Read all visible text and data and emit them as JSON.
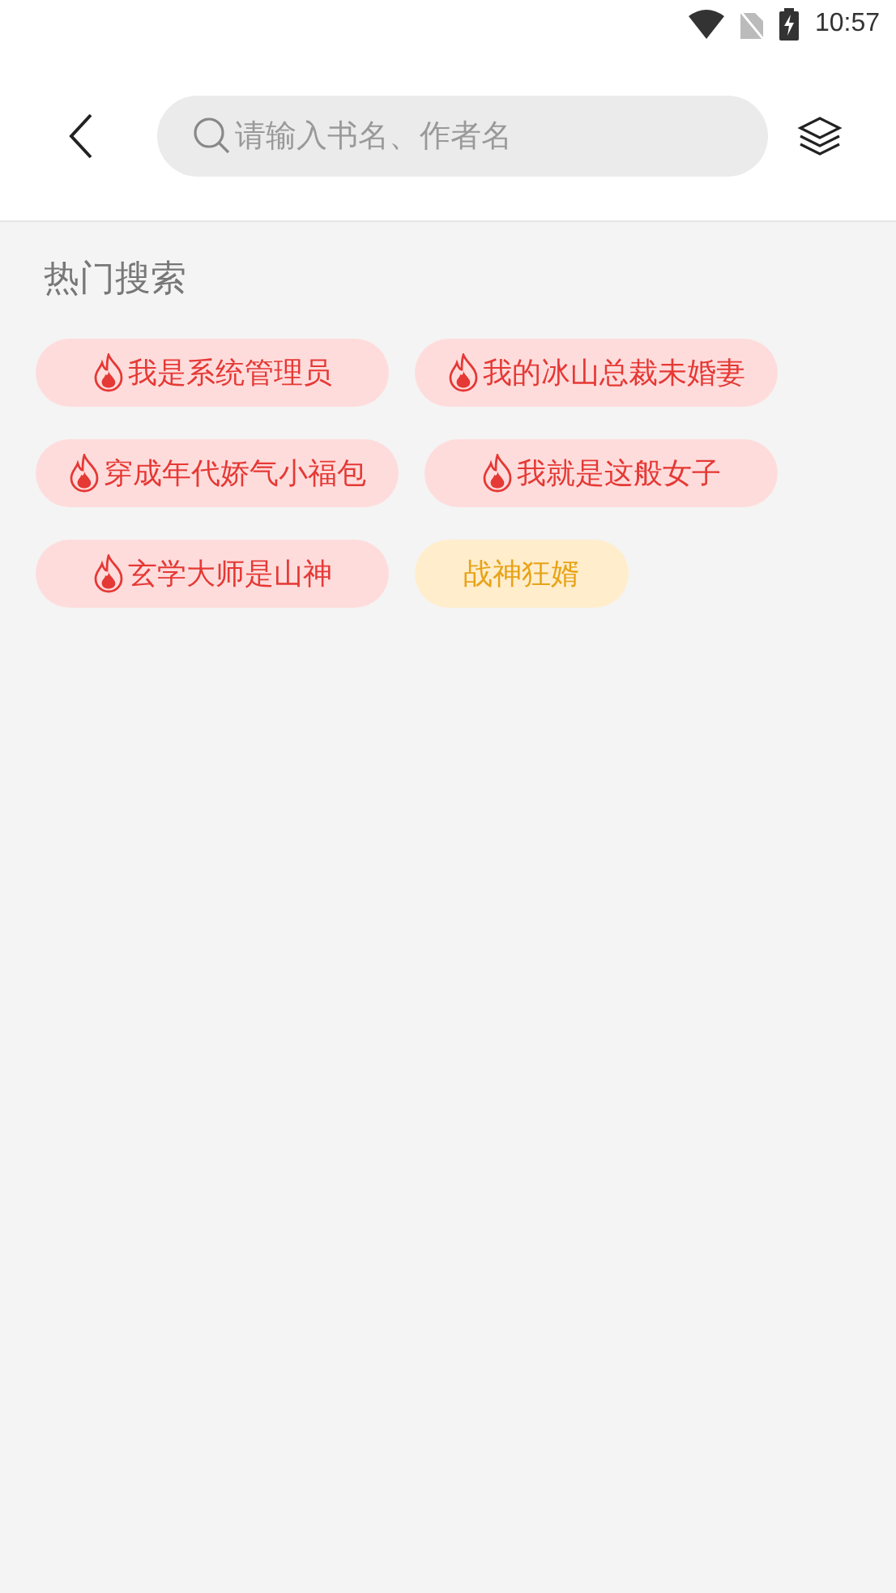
{
  "status_bar": {
    "time": "10:57"
  },
  "search": {
    "placeholder": "请输入书名、作者名"
  },
  "hot_search": {
    "title": "热门搜索",
    "tags": [
      {
        "label": "我是系统管理员",
        "kind": "hot"
      },
      {
        "label": "我的冰山总裁未婚妻",
        "kind": "hot"
      },
      {
        "label": "穿成年代娇气小福包",
        "kind": "hot"
      },
      {
        "label": "我就是这般女子",
        "kind": "hot"
      },
      {
        "label": "玄学大师是山神",
        "kind": "hot"
      },
      {
        "label": "战神狂婿",
        "kind": "plain"
      }
    ]
  }
}
